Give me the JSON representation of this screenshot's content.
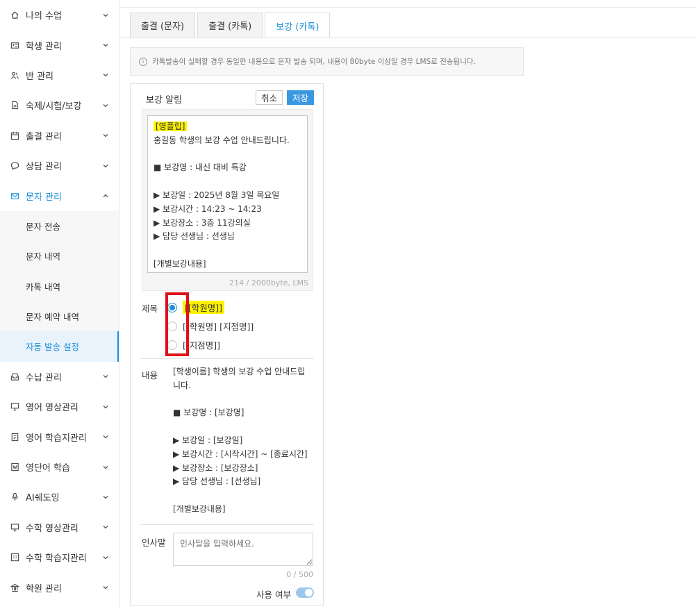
{
  "sidebar": {
    "items": [
      {
        "label": "나의 수업",
        "icon": "home-icon"
      },
      {
        "label": "학생 관리",
        "icon": "id-card-icon"
      },
      {
        "label": "반 관리",
        "icon": "users-icon"
      },
      {
        "label": "숙제/시험/보강",
        "icon": "document-icon"
      },
      {
        "label": "출결 관리",
        "icon": "calendar-icon"
      },
      {
        "label": "상담 관리",
        "icon": "chat-icon"
      },
      {
        "label": "문자 관리",
        "icon": "mail-icon"
      }
    ],
    "subitems": [
      {
        "label": "문자 전송"
      },
      {
        "label": "문자 내역"
      },
      {
        "label": "카톡 내역"
      },
      {
        "label": "문자 예약 내역"
      },
      {
        "label": "자동 발송 설정"
      }
    ],
    "items_after": [
      {
        "label": "수납 관리",
        "icon": "inbox-icon"
      },
      {
        "label": "영어 영상관리",
        "icon": "monitor-icon"
      },
      {
        "label": "영어 학습지관리",
        "icon": "book-icon"
      },
      {
        "label": "영단어 학습",
        "icon": "word-book-icon"
      },
      {
        "label": "AI쉐도잉",
        "icon": "microphone-icon"
      },
      {
        "label": "수학 영상관리",
        "icon": "monitor-icon"
      },
      {
        "label": "수학 학습지관리",
        "icon": "worksheet-icon"
      },
      {
        "label": "학원 관리",
        "icon": "building-icon"
      }
    ],
    "accent_color": "#1a8ed8"
  },
  "tabs": [
    {
      "label": "출결 (문자)"
    },
    {
      "label": "출결 (카톡)"
    },
    {
      "label": "보강 (카톡)"
    }
  ],
  "notice": {
    "text": "카톡발송이 실패할 경우 동일한 내용으로 문자 발송 되며, 내용이 80byte 이상일 경우 LMS로 전송됩니다."
  },
  "panel": {
    "title": "보강 알림",
    "cancel_label": "취소",
    "save_label": "저장",
    "preview": {
      "highlight": "[영플립]",
      "lines": [
        "홍길동 학생의 보강 수업 안내드립니다.",
        "",
        "■ 보강명 : 내신 대비 특강",
        "",
        "▶ 보강일 : 2025년 8월 3일 목요일",
        "▶ 보강시간 : 14:23 ~ 14:23",
        "▶ 보강장소 : 3층 11강의실",
        "▶ 담당 선생님 : 선생님",
        "",
        "[개별보강내용]"
      ],
      "byte_count": "214 / 2000byte, LMS"
    },
    "subject_label": "제목",
    "subject_options": [
      {
        "label": "[[학원명]]"
      },
      {
        "label": "[[학원명] [지점명]]"
      },
      {
        "label": "[[지점명]]"
      }
    ],
    "content_label": "내용",
    "content_lines": [
      "[학생이름] 학생의 보강 수업 안내드립",
      "니다.",
      "",
      "■ 보강명 : [보강명]",
      "",
      "▶ 보강일 : [보강일]",
      "▶ 보강시간 : [시작시간] ~ [종료시간]",
      "▶ 보강장소 : [보강장소]",
      "▶ 담당 선생님 : [선생님]",
      "",
      "[개별보강내용]"
    ],
    "greeting_label": "인사말",
    "greeting_placeholder": "인사말을 입력하세요.",
    "greeting_count": "0 / 500",
    "use_label": "사용 여부",
    "use_enabled": true
  }
}
